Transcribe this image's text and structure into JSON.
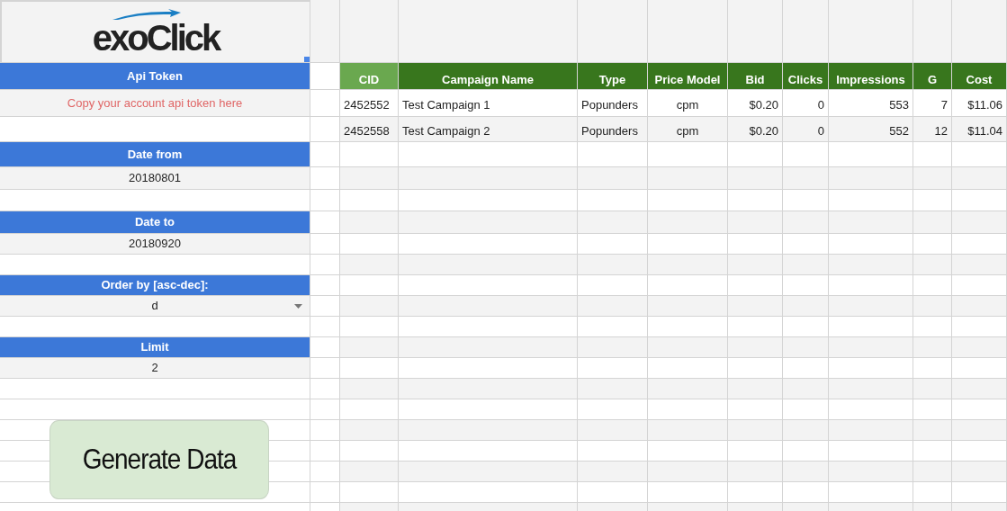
{
  "logo": {
    "text": "exoClick",
    "selected": true
  },
  "form": [
    {
      "label": "Api Token",
      "value": "Copy your account api token here",
      "kind": "hint"
    },
    {
      "label": "Date from",
      "value": "20180801",
      "kind": "text"
    },
    {
      "label": "Date to",
      "value": "20180920",
      "kind": "text"
    },
    {
      "label": "Order by [asc-dec]:",
      "value": "d",
      "kind": "dropdown"
    },
    {
      "label": "Limit",
      "value": "2",
      "kind": "text"
    }
  ],
  "button": {
    "label": "Generate Data"
  },
  "table": {
    "columns": [
      {
        "label": "CID",
        "color": "#6aa84f"
      },
      {
        "label": "Campaign Name",
        "color": "#38761d"
      },
      {
        "label": "Type",
        "color": "#38761d"
      },
      {
        "label": "Price Model",
        "color": "#38761d"
      },
      {
        "label": "Bid",
        "color": "#38761d"
      },
      {
        "label": "Clicks",
        "color": "#38761d"
      },
      {
        "label": "Impressions",
        "color": "#38761d"
      },
      {
        "label": "G",
        "color": "#38761d"
      },
      {
        "label": "Cost",
        "color": "#38761d"
      }
    ],
    "rows": [
      [
        "2452552",
        "Test Campaign 1",
        "Popunders",
        "cpm",
        "$0.20",
        "0",
        "553",
        "7",
        "$11.06"
      ],
      [
        "2452558",
        "Test Campaign 2",
        "Popunders",
        "cpm",
        "$0.20",
        "0",
        "552",
        "12",
        "$11.04"
      ]
    ]
  }
}
